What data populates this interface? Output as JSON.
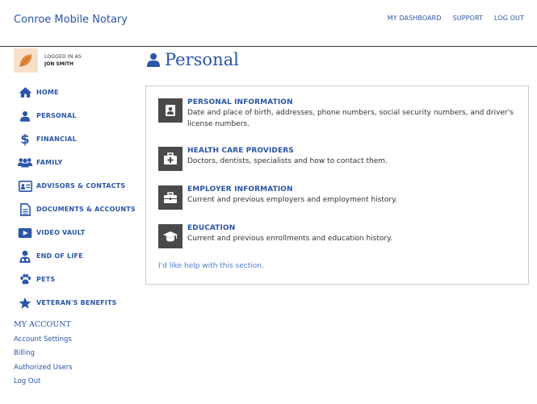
{
  "brand": "Conroe Mobile Notary",
  "topnav": [
    "MY DASHBOARD",
    "SUPPORT",
    "LOG OUT"
  ],
  "user": {
    "logged_in_label": "LOGGED IN AS",
    "name": "JON SMITH"
  },
  "sidebar": {
    "items": [
      {
        "label": "HOME",
        "icon": "home-icon"
      },
      {
        "label": "PERSONAL",
        "icon": "person-icon"
      },
      {
        "label": "FINANCIAL",
        "icon": "dollar-icon"
      },
      {
        "label": "FAMILY",
        "icon": "family-icon"
      },
      {
        "label": "ADVISORS & CONTACTS",
        "icon": "contact-card-icon"
      },
      {
        "label": "DOCUMENTS & ACCOUNTS",
        "icon": "document-icon"
      },
      {
        "label": "VIDEO VAULT",
        "icon": "video-icon"
      },
      {
        "label": "END OF LIFE",
        "icon": "doctor-icon"
      },
      {
        "label": "PETS",
        "icon": "paw-icon"
      },
      {
        "label": "VETERAN'S BENEFITS",
        "icon": "star-icon"
      }
    ]
  },
  "account": {
    "title": "MY ACCOUNT",
    "links": [
      "Account Settings",
      "Billing",
      "Authorized Users",
      "Log Out"
    ]
  },
  "page": {
    "title": "Personal",
    "icon": "person-icon"
  },
  "sections": [
    {
      "title": "PERSONAL INFORMATION",
      "desc": "Date and place of birth, addresses, phone numbers, social security numbers, and driver's license numbers.",
      "icon": "id-person-icon"
    },
    {
      "title": "HEALTH CARE PROVIDERS",
      "desc": "Doctors, dentists, specialists and how to contact them.",
      "icon": "medical-kit-icon"
    },
    {
      "title": "EMPLOYER INFORMATION",
      "desc": "Current and previous employers and employment history.",
      "icon": "briefcase-icon"
    },
    {
      "title": "EDUCATION",
      "desc": "Current and previous enrollments and education history.",
      "icon": "graduation-cap-icon"
    }
  ],
  "help_link": "I'd like help with this section.",
  "colors": {
    "accent": "#2a55a8",
    "icon_box": "#4a4a4a",
    "avatar_bg": "#f7dfc9"
  }
}
